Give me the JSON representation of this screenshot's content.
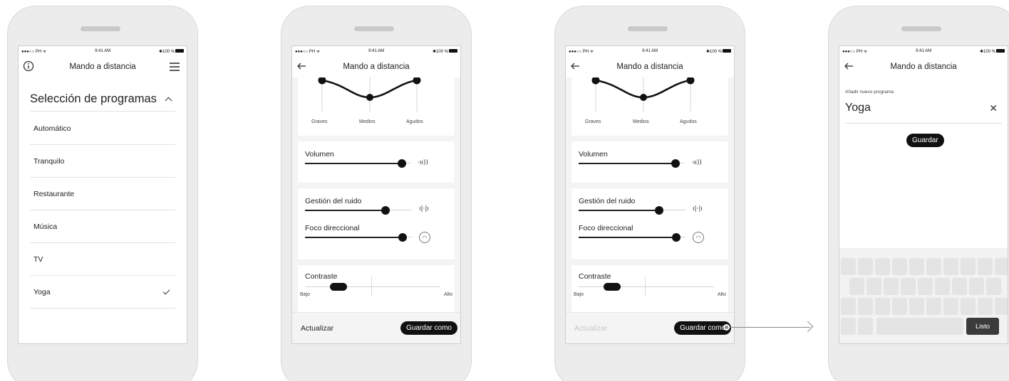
{
  "status": {
    "carrier": "●●●○○ PH ᯤ",
    "time": "9:41 AM",
    "battery": "✱100 %"
  },
  "screen1": {
    "title": "Mando a distancia",
    "section": "Selección de programas",
    "programs": [
      "Automático",
      "Tranquilo",
      "Restaurante",
      "Música",
      "TV",
      "Yoga"
    ],
    "selected": "Yoga"
  },
  "screen2": {
    "title": "Mando a distancia",
    "eq": {
      "low": "Graves",
      "mid": "Medios",
      "high": "Agudos"
    },
    "volume": {
      "label": "Volumen",
      "level": 0.9
    },
    "noise": {
      "label": "Gestión del ruido",
      "level": 0.8
    },
    "focus": {
      "label": "Foco direccional",
      "level": 0.9
    },
    "contrast": {
      "label": "Contraste",
      "min": "Bajo",
      "max": "Alto",
      "level": 0.3
    },
    "update_label": "Actualizar",
    "save_as_label": "Guardar como"
  },
  "screen3": {
    "title": "Mando a distancia",
    "eq": {
      "low": "Graves",
      "mid": "Medios",
      "high": "Agudos"
    },
    "volume": {
      "label": "Volumen"
    },
    "noise": {
      "label": "Gestión del ruido"
    },
    "focus": {
      "label": "Foco direccional"
    },
    "contrast": {
      "label": "Contraste",
      "min": "Bajo",
      "max": "Alto"
    },
    "update_label": "Actualizar",
    "save_as_label": "Guardar como"
  },
  "screen4": {
    "title": "Mando a distancia",
    "field_label": "Añadir nuevo programa",
    "field_value": "Yoga",
    "save_label": "Guardar",
    "done_label": "Listo"
  },
  "icons": {
    "info": "info-icon",
    "menu": "menu-icon",
    "back": "back-arrow-icon",
    "check": "check-icon",
    "volume": "volume-icon",
    "noise": "noise-icon",
    "focus": "focus-icon",
    "close": "close-icon"
  }
}
